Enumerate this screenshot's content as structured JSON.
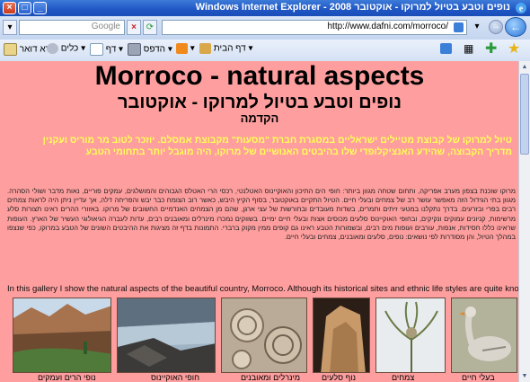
{
  "window": {
    "title": "נופים וטבע בטיול למרוקו - אוקטובר 2008 - Windows Internet Explorer"
  },
  "address_bar": {
    "url": "http://www.dafni.com/morroco/",
    "search_label": "Google"
  },
  "toolbar": {
    "home": "דף הבית",
    "print": "הדפס",
    "page": "דף",
    "tools": "כלים",
    "read_mail": "קרא דואר"
  },
  "page": {
    "title": "Morroco - natural aspects",
    "subtitle": "נופים וטבע בטיול למרוקו - אוקטובר",
    "intro_heading": "הקדמה",
    "intro_yellow": "טיול למרוקו של קבוצת מטיילים ישראליים במסגרת חברת \"מסעות\" מקבוצת אמסלם. יוזכר לטוב מר מוריס ועקנין מדריך הקבוצה, שהידע האנציקלופדי שלו בהיבטים האנושיים של מרוקו, היה מוגבל יותר בתחומי הטבע",
    "hebrew_body": "מרוקו שוכנת בצפון מערב אפריקה, ותחום שטחה מגוון ביותר: חופי הים התיכון והאוקיינוס האטלנטי, רכסי הרי האטלס הגבוהים והמושלגים, עמקים פוריים, נאות מדבר ושולי הסהרה. מגוון בתי הגידול הזה מאפשר עושר רב של צמחים ובעלי חיים. הטיול התקיים באוקטובר, בסוף הקיץ היבש, כאשר רוב הצומח כבר יבש והפריחה דלה, אך עדיין ניתן היה לראות צמחים רבים בפרי ובזרעים. בדרך נתקלנו במטעי זיתים ותמרים, בשדות מעובדים ובחורשות של עצי ארגן, שהם מן הצמחים האנדמיים החשובים של מרוקו. באזורי ההרים ראינו תצורות סלע מרשימות, קניונים עמוקים ונקיקים, ובחופי האוקיינוס סלעים מכוסים אצות ובעלי חיים ימיים. בשווקים נמכרו מינרלים ומאובנים רבים, עדות לעברה הגיאולוגי העשיר של הארץ. העופות שראינו כללו חסידות, אנפות, עורבים ועופות מים רבים, ובשמורות הטבע ראינו גם קופים ממין מקוק ברברי. התמונות בדף זה מציגות את ההיבטים השונים של הטבע במרוקו, כפי שנצפו במהלך הטיול, והן מסודרות לפי נושאים: נופים, סלעים ומאובנים, צמחים ובעלי חיים.",
    "english_line": "In this gallery I show the natural aspects of the beautiful country, Morroco. Although its historical sites and ethnic life styles are quite known and"
  },
  "photos": [
    {
      "caption": "נופי הרים ועמקים"
    },
    {
      "caption": "חופי האוקיינוס"
    },
    {
      "caption": "מינרלים ומאובנים"
    },
    {
      "caption": "נוף סלעים"
    },
    {
      "caption": "צמחים"
    },
    {
      "caption": "בעלי חיים"
    }
  ]
}
